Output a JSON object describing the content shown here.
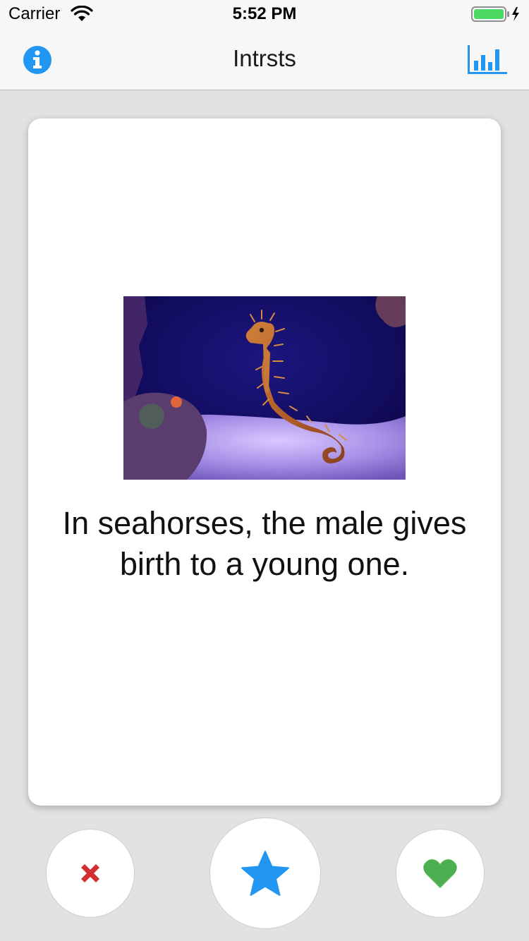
{
  "status_bar": {
    "carrier": "Carrier",
    "time": "5:52 PM",
    "wifi_icon": "wifi-icon",
    "battery_icon": "battery-charging-icon",
    "battery_color": "#4cd964"
  },
  "nav": {
    "title": "Intrsts",
    "left_icon": "info-icon",
    "right_icon": "bar-chart-icon",
    "accent_color": "#2196f3"
  },
  "card": {
    "image_subject": "seahorse",
    "fact": "In seahorses, the male gives birth to a young one."
  },
  "actions": {
    "dislike_icon": "close-icon",
    "dislike_color": "#d32f2f",
    "favorite_icon": "star-icon",
    "favorite_color": "#2196f3",
    "like_icon": "heart-icon",
    "like_color": "#4caf50"
  }
}
